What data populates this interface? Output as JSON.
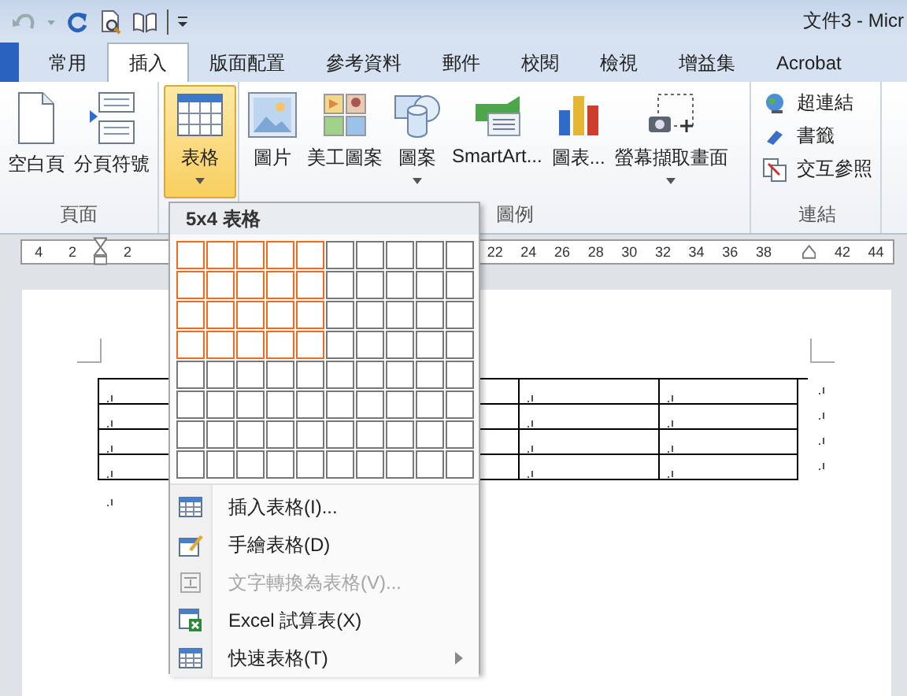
{
  "title_bar": {
    "title": "文件3 - Micr"
  },
  "tabs": [
    {
      "label": "常用",
      "selected": false
    },
    {
      "label": "插入",
      "selected": true
    },
    {
      "label": "版面配置",
      "selected": false
    },
    {
      "label": "參考資料",
      "selected": false
    },
    {
      "label": "郵件",
      "selected": false
    },
    {
      "label": "校閱",
      "selected": false
    },
    {
      "label": "檢視",
      "selected": false
    },
    {
      "label": "增益集",
      "selected": false
    },
    {
      "label": "Acrobat",
      "selected": false
    }
  ],
  "ribbon_groups": [
    {
      "label": "頁面",
      "kind": "large",
      "commands": [
        {
          "label": "空白頁",
          "dropdown": false,
          "selected": false
        },
        {
          "label": "分頁符號",
          "dropdown": false,
          "selected": false
        }
      ]
    },
    {
      "kind": "large",
      "commands": [
        {
          "label": "表格",
          "dropdown": true,
          "selected": true
        }
      ]
    },
    {
      "label": "圖例",
      "kind": "large",
      "commands": [
        {
          "label": "圖片",
          "dropdown": false,
          "selected": false
        },
        {
          "label": "美工圖案",
          "dropdown": false,
          "selected": false
        },
        {
          "label": "圖案",
          "dropdown": true,
          "selected": false
        },
        {
          "label": "SmartArt...",
          "dropdown": false,
          "selected": false
        },
        {
          "label": "圖表...",
          "dropdown": false,
          "selected": false
        },
        {
          "label": "螢幕擷取畫面",
          "dropdown": true,
          "selected": false
        }
      ]
    },
    {
      "label": "連結",
      "kind": "small",
      "commands": [
        {
          "label": "超連結"
        },
        {
          "label": "書籤"
        },
        {
          "label": "交互參照"
        }
      ]
    }
  ],
  "ruler": {
    "left_numbers": [
      "4",
      "2"
    ],
    "numbers": [
      "2"
    ],
    "right_numbers": [
      "22",
      "24",
      "26",
      "28",
      "30",
      "32",
      "34",
      "36",
      "38"
    ],
    "end_numbers": [
      "42",
      "44"
    ]
  },
  "table_menu": {
    "header": "5x4 表格",
    "grid": [
      {
        "cells": [
          {
            "selected": true
          },
          {
            "selected": true
          },
          {
            "selected": true
          },
          {
            "selected": true
          },
          {
            "selected": true
          },
          {
            "selected": false
          },
          {
            "selected": false
          },
          {
            "selected": false
          },
          {
            "selected": false
          },
          {
            "selected": false
          }
        ]
      },
      {
        "cells": [
          {
            "selected": true
          },
          {
            "selected": true
          },
          {
            "selected": true
          },
          {
            "selected": true
          },
          {
            "selected": true
          },
          {
            "selected": false
          },
          {
            "selected": false
          },
          {
            "selected": false
          },
          {
            "selected": false
          },
          {
            "selected": false
          }
        ]
      },
      {
        "cells": [
          {
            "selected": true
          },
          {
            "selected": true
          },
          {
            "selected": true
          },
          {
            "selected": true
          },
          {
            "selected": true
          },
          {
            "selected": false
          },
          {
            "selected": false
          },
          {
            "selected": false
          },
          {
            "selected": false
          },
          {
            "selected": false
          }
        ]
      },
      {
        "cells": [
          {
            "selected": true
          },
          {
            "selected": true
          },
          {
            "selected": true
          },
          {
            "selected": true
          },
          {
            "selected": true
          },
          {
            "selected": false
          },
          {
            "selected": false
          },
          {
            "selected": false
          },
          {
            "selected": false
          },
          {
            "selected": false
          }
        ]
      },
      {
        "cells": [
          {
            "selected": false
          },
          {
            "selected": false
          },
          {
            "selected": false
          },
          {
            "selected": false
          },
          {
            "selected": false
          },
          {
            "selected": false
          },
          {
            "selected": false
          },
          {
            "selected": false
          },
          {
            "selected": false
          },
          {
            "selected": false
          }
        ]
      },
      {
        "cells": [
          {
            "selected": false
          },
          {
            "selected": false
          },
          {
            "selected": false
          },
          {
            "selected": false
          },
          {
            "selected": false
          },
          {
            "selected": false
          },
          {
            "selected": false
          },
          {
            "selected": false
          },
          {
            "selected": false
          },
          {
            "selected": false
          }
        ]
      },
      {
        "cells": [
          {
            "selected": false
          },
          {
            "selected": false
          },
          {
            "selected": false
          },
          {
            "selected": false
          },
          {
            "selected": false
          },
          {
            "selected": false
          },
          {
            "selected": false
          },
          {
            "selected": false
          },
          {
            "selected": false
          },
          {
            "selected": false
          }
        ]
      },
      {
        "cells": [
          {
            "selected": false
          },
          {
            "selected": false
          },
          {
            "selected": false
          },
          {
            "selected": false
          },
          {
            "selected": false
          },
          {
            "selected": false
          },
          {
            "selected": false
          },
          {
            "selected": false
          },
          {
            "selected": false
          },
          {
            "selected": false
          }
        ]
      }
    ],
    "items": [
      {
        "label": "插入表格(I)...",
        "disabled": false,
        "submenu": false
      },
      {
        "label": "手繪表格(D)",
        "disabled": false,
        "submenu": false
      },
      {
        "label": "文字轉換為表格(V)...",
        "disabled": true,
        "submenu": false
      },
      {
        "label": "Excel 試算表(X)",
        "disabled": false,
        "submenu": false
      },
      {
        "label": "快速表格(T)",
        "disabled": false,
        "submenu": true
      }
    ]
  }
}
